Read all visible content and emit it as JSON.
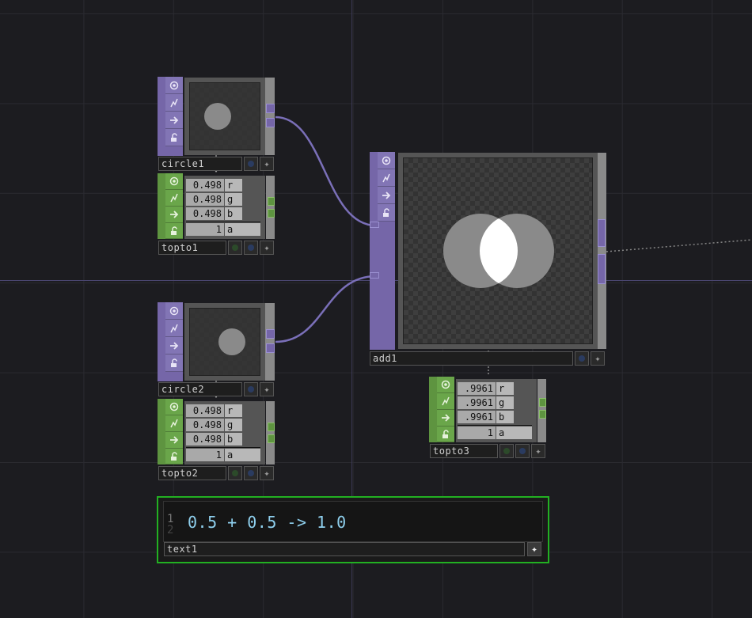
{
  "nodes": {
    "circle1": {
      "name": "circle1"
    },
    "topto1": {
      "name": "topto1",
      "rows": [
        {
          "value": "0.498",
          "channel": "r"
        },
        {
          "value": "0.498",
          "channel": "g"
        },
        {
          "value": "0.498",
          "channel": "b"
        },
        {
          "value": "1",
          "channel": "a"
        }
      ]
    },
    "circle2": {
      "name": "circle2"
    },
    "topto2": {
      "name": "topto2",
      "rows": [
        {
          "value": "0.498",
          "channel": "r"
        },
        {
          "value": "0.498",
          "channel": "g"
        },
        {
          "value": "0.498",
          "channel": "b"
        },
        {
          "value": "1",
          "channel": "a"
        }
      ]
    },
    "add1": {
      "name": "add1"
    },
    "topto3": {
      "name": "topto3",
      "rows": [
        {
          "value": ".9961",
          "channel": "r"
        },
        {
          "value": ".9961",
          "channel": "g"
        },
        {
          "value": ".9961",
          "channel": "b"
        },
        {
          "value": "1",
          "channel": "a"
        }
      ]
    },
    "text1": {
      "name": "text1",
      "line_numbers": [
        "1",
        "2"
      ],
      "text": "0.5 + 0.5 -> 1.0"
    }
  },
  "icons": [
    "viewer-icon",
    "cook-icon",
    "arrow-right-icon",
    "lock-icon"
  ],
  "colors": {
    "background": "#1c1c20",
    "top_family": "#7566a8",
    "chop_family": "#5e9440",
    "wire": "#7a6fb8",
    "dat_border": "#22b022",
    "text": "#8fd0ee"
  }
}
